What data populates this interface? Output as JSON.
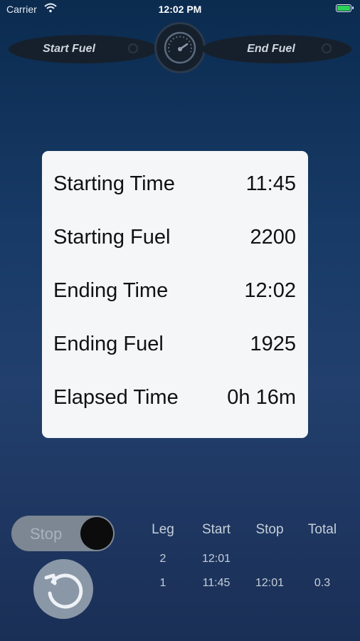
{
  "status_bar": {
    "carrier": "Carrier",
    "time": "12:02 PM"
  },
  "header": {
    "start_fuel_label": "Start Fuel",
    "end_fuel_label": "End Fuel"
  },
  "summary": {
    "rows": [
      {
        "label": "Starting Time",
        "value": "11:45"
      },
      {
        "label": "Starting Fuel",
        "value": "2200"
      },
      {
        "label": "Ending Time",
        "value": "12:02"
      },
      {
        "label": "Ending Fuel",
        "value": "1925"
      },
      {
        "label": "Elapsed Time",
        "value": "0h 16m"
      }
    ]
  },
  "controls": {
    "toggle_label": "Stop"
  },
  "legs_table": {
    "headers": [
      "Leg",
      "Start",
      "Stop",
      "Total"
    ],
    "rows": [
      {
        "leg": "2",
        "start": "12:01",
        "stop": "",
        "total": ""
      },
      {
        "leg": "1",
        "start": "11:45",
        "stop": "12:01",
        "total": "0.3"
      }
    ]
  },
  "colors": {
    "background": "#173a66",
    "toggle": "#7c8793",
    "battery": "#2ed158"
  },
  "icons": [
    "wifi-icon",
    "battery-icon",
    "fuel-gauge-icon",
    "reset-icon"
  ]
}
